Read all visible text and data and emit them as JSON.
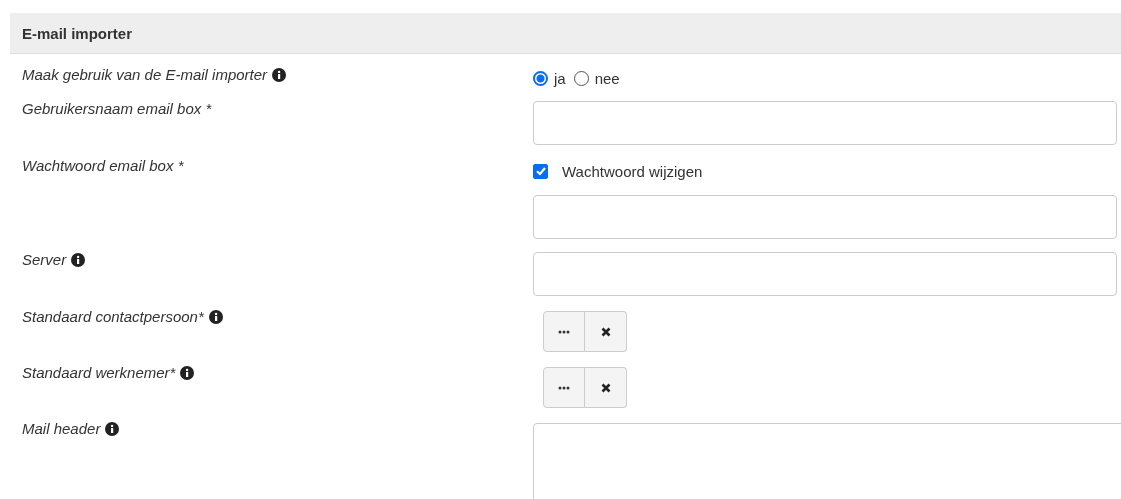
{
  "section": {
    "title": "E-mail importer"
  },
  "rows": [
    {
      "label": "Maak gebruik van de E-mail importer",
      "info": true,
      "kind": "radio",
      "options": [
        {
          "label": "ja",
          "selected": true
        },
        {
          "label": "nee",
          "selected": false
        }
      ]
    },
    {
      "label": "Gebruikersnaam email box *",
      "info": false,
      "kind": "text"
    },
    {
      "label": "Wachtwoord email box *",
      "info": false,
      "kind": "password",
      "checkbox": {
        "label": "Wachtwoord wijzigen",
        "checked": true
      }
    },
    {
      "label": "Server",
      "info": true,
      "kind": "text"
    },
    {
      "label": "Standaard contactpersoon*",
      "info": true,
      "kind": "picker"
    },
    {
      "label": "Standaard werknemer*",
      "info": true,
      "kind": "picker"
    },
    {
      "label": "Mail header",
      "info": true,
      "kind": "textarea"
    }
  ]
}
